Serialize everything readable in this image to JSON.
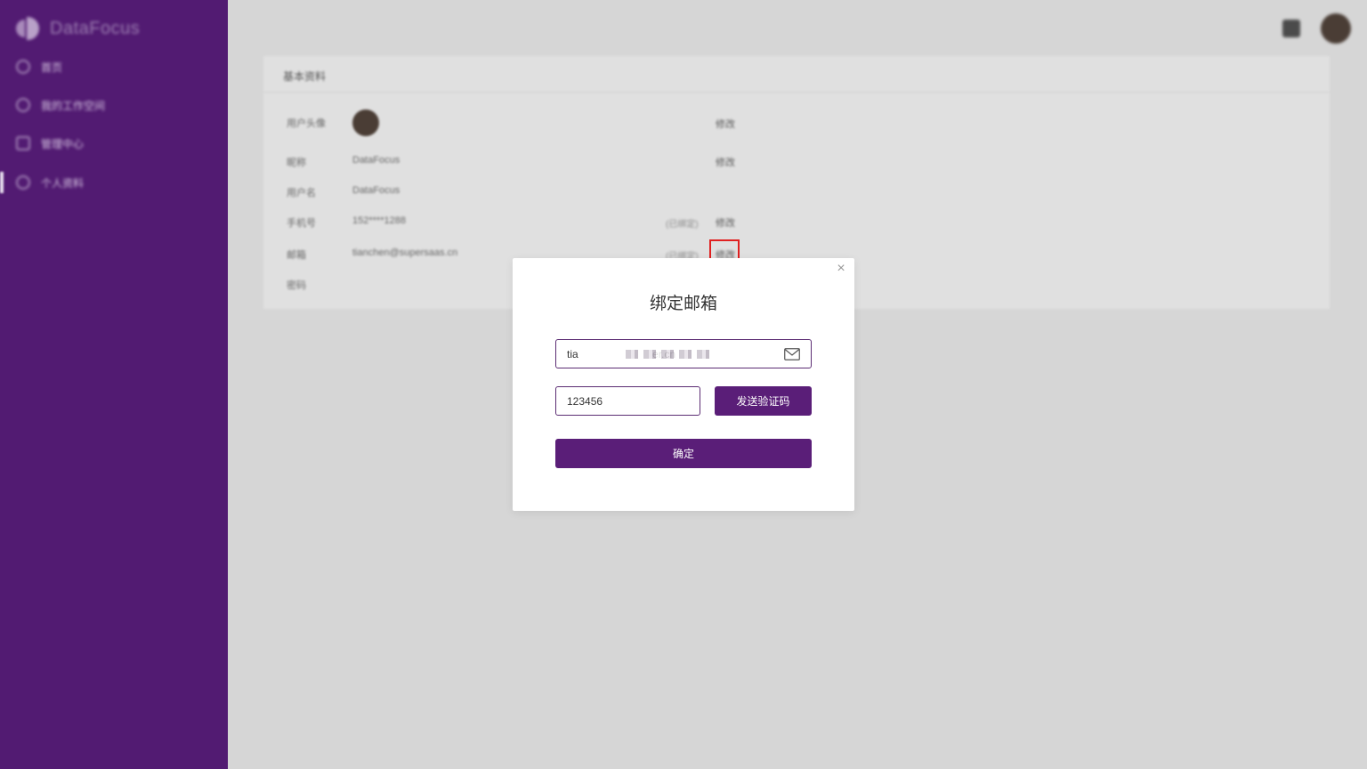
{
  "sidebar": {
    "brand": "DataFocus",
    "items": [
      {
        "label": "首页"
      },
      {
        "label": "我的工作空间"
      },
      {
        "label": "管理中心"
      },
      {
        "label": "个人资料"
      }
    ]
  },
  "profile_card": {
    "title": "基本资料",
    "rows": [
      {
        "label": "用户头像",
        "value": "",
        "tag": "",
        "action": "修改"
      },
      {
        "label": "昵称",
        "value": "DataFocus",
        "tag": "",
        "action": "修改"
      },
      {
        "label": "用户名",
        "value": "DataFocus",
        "tag": "",
        "action": ""
      },
      {
        "label": "手机号",
        "value": "152****1288",
        "tag": "(已绑定)",
        "action": "修改"
      },
      {
        "label": "邮箱",
        "value": "tianchen@supersaas.cn",
        "tag": "(已绑定)",
        "action": "修改"
      },
      {
        "label": "密码",
        "value": "",
        "tag": "",
        "action": ""
      }
    ]
  },
  "modal": {
    "title": "绑定邮箱",
    "email_value": "tia                         er.cn",
    "code_value": "123456",
    "send_code_label": "发送验证码",
    "confirm_label": "确定",
    "close_label": "×"
  },
  "colors": {
    "sidebar": "#521b72",
    "primary": "#5a1e78",
    "highlight": "#e02020"
  }
}
